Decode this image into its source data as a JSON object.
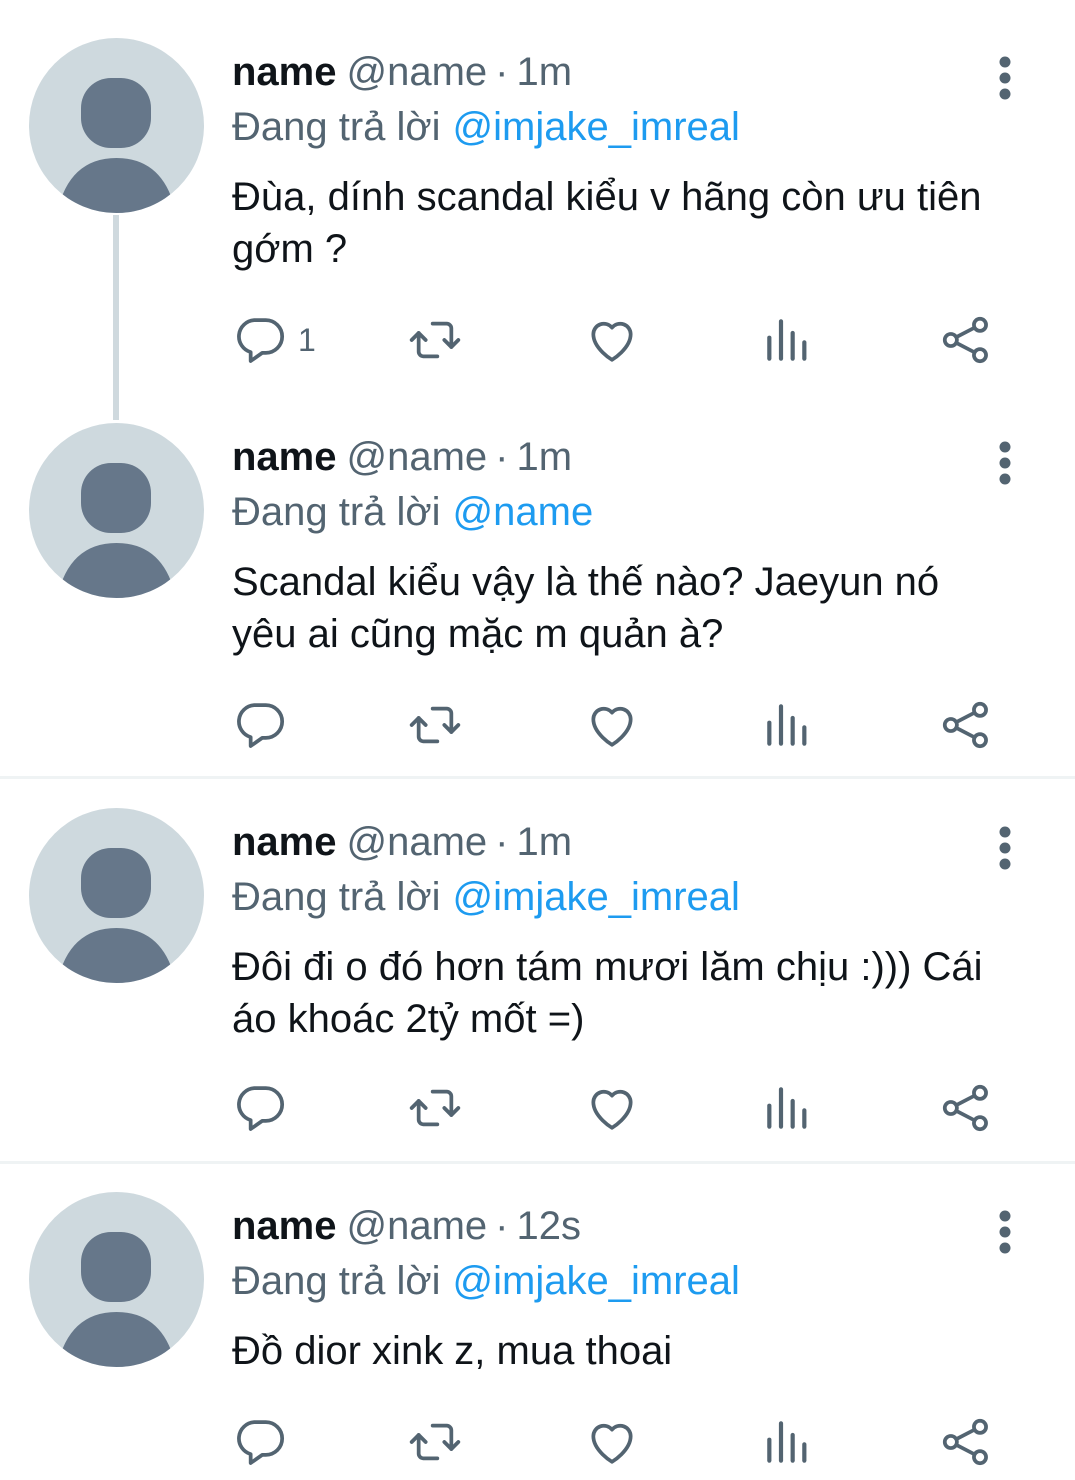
{
  "tweets": [
    {
      "display_name": "name",
      "handle": "@name",
      "separator": "·",
      "time": "1m",
      "reply_prefix": "Đang trả lời",
      "reply_to": "@imjake_imreal",
      "text": "Đùa, dính scandal kiểu v hãng còn ưu tiên\ngớm ?",
      "reply_count": "1"
    },
    {
      "display_name": "name",
      "handle": "@name",
      "separator": "·",
      "time": "1m",
      "reply_prefix": "Đang trả lời",
      "reply_to": "@name",
      "text": "Scandal kiểu vậy là thế nào? Jaeyun nó\nyêu ai cũng mặc m quản à?",
      "reply_count": ""
    },
    {
      "display_name": "name",
      "handle": "@name",
      "separator": "·",
      "time": "1m",
      "reply_prefix": "Đang trả lời",
      "reply_to": "@imjake_imreal",
      "text": "Đôi đi o đó hơn tám mươi lăm chịu :))) Cái\náo khoác 2tỷ mốt =)",
      "reply_count": ""
    },
    {
      "display_name": "name",
      "handle": "@name",
      "separator": "·",
      "time": "12s",
      "reply_prefix": "Đang trả lời",
      "reply_to": "@imjake_imreal",
      "text": "Đồ dior xink z, mua thoai",
      "reply_count": ""
    }
  ],
  "icons": {
    "avatar": "default-avatar-icon",
    "more": "more-vertical-icon",
    "reply": "reply-icon",
    "retweet": "retweet-icon",
    "like": "heart-icon",
    "views": "views-icon",
    "share": "share-icon"
  },
  "colors": {
    "text_primary": "#0f1419",
    "text_secondary": "#536471",
    "link": "#1d9bf0",
    "avatar_bg": "#ced9de",
    "avatar_figure": "#66778a",
    "thread_line": "#cfd9de",
    "divider": "#eff3f4"
  }
}
